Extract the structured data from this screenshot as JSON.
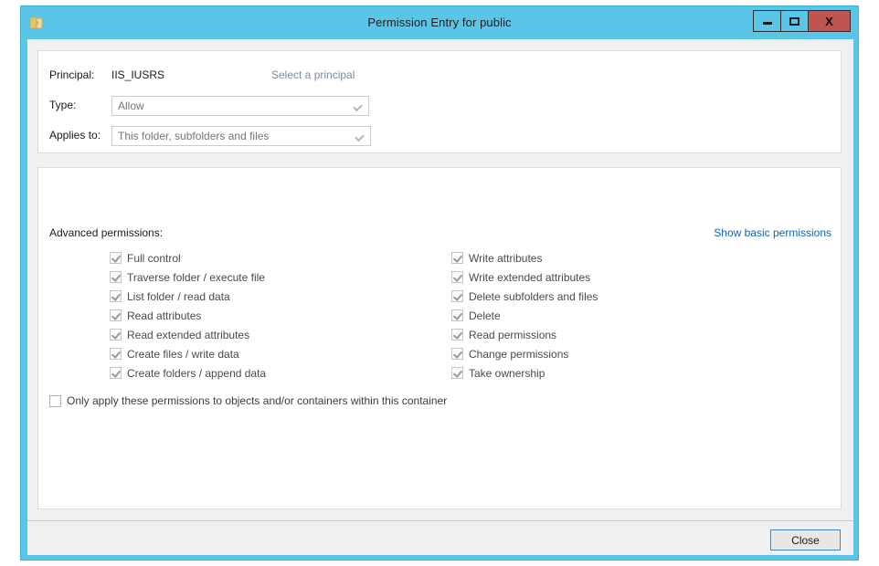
{
  "window": {
    "title": "Permission Entry for public",
    "icon": "folder-icon",
    "accent_color": "#5bc5e8",
    "close_color": "#bf5450",
    "controls": {
      "minimize": "minimize-icon",
      "maximize": "maximize-icon",
      "close": "X"
    }
  },
  "form": {
    "principal_label": "Principal:",
    "principal_value": "IIS_IUSRS",
    "select_principal_link": "Select a principal",
    "type_label": "Type:",
    "type_value": "Allow",
    "applies_to_label": "Applies to:",
    "applies_to_value": "This folder, subfolders and files"
  },
  "permissions": {
    "header": "Advanced permissions:",
    "toggle_link": "Show basic permissions",
    "toggle_link_color": "#0c62c6",
    "left_column": [
      {
        "label": "Full control",
        "checked": true
      },
      {
        "label": "Traverse folder / execute file",
        "checked": true
      },
      {
        "label": "List folder / read data",
        "checked": true
      },
      {
        "label": "Read attributes",
        "checked": true
      },
      {
        "label": "Read extended attributes",
        "checked": true
      },
      {
        "label": "Create files / write data",
        "checked": true
      },
      {
        "label": "Create folders / append data",
        "checked": true
      }
    ],
    "right_column": [
      {
        "label": "Write attributes",
        "checked": true
      },
      {
        "label": "Write extended attributes",
        "checked": true
      },
      {
        "label": "Delete subfolders and files",
        "checked": true
      },
      {
        "label": "Delete",
        "checked": true
      },
      {
        "label": "Read permissions",
        "checked": true
      },
      {
        "label": "Change permissions",
        "checked": true
      },
      {
        "label": "Take ownership",
        "checked": true
      }
    ],
    "container_option": {
      "label": "Only apply these permissions to objects and/or containers within this container",
      "checked": false
    }
  },
  "footer": {
    "close_label": "Close"
  }
}
